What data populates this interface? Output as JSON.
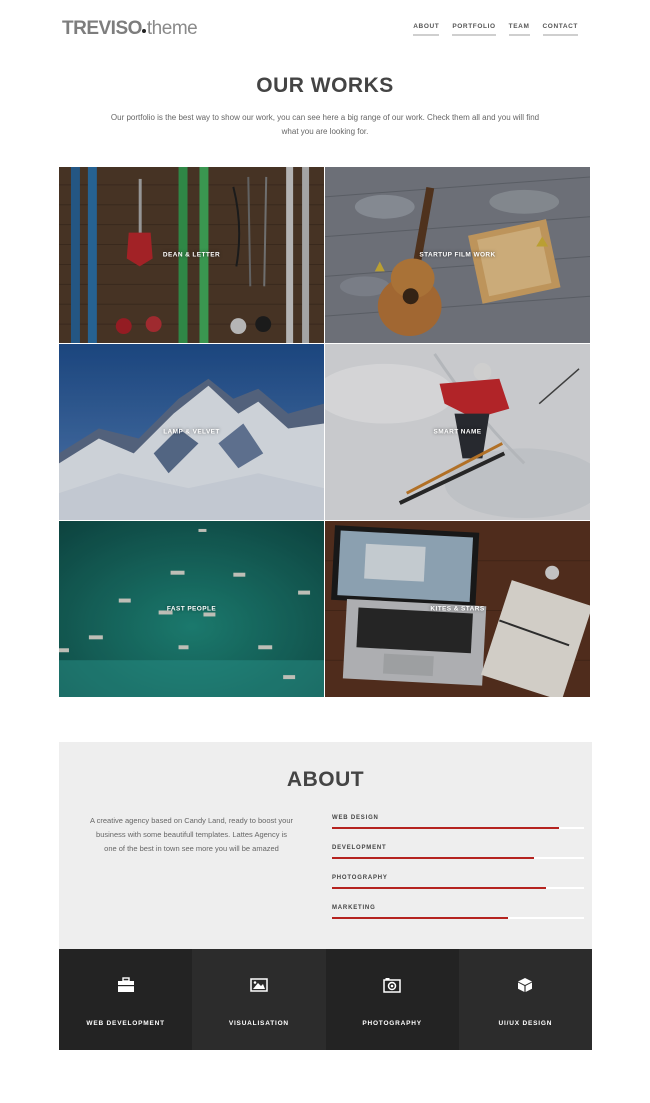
{
  "brand": {
    "logo_bold": "TREVISO",
    "logo_light": "theme"
  },
  "nav": [
    {
      "label": "ABOUT"
    },
    {
      "label": "PORTFOLIO"
    },
    {
      "label": "TEAM"
    },
    {
      "label": "CONTACT"
    }
  ],
  "works": {
    "title": "OUR WORKS",
    "intro": "Our portfolio is the best way to show our work, you can see here a big range of our work. Check them all and you will find what you are looking for.",
    "items": [
      {
        "label": "DEAN & LETTER",
        "image": "skis-on-wooden-deck"
      },
      {
        "label": "STARTUP FILM WORK",
        "image": "ukulele-and-book"
      },
      {
        "label": "LAMP & VELVET",
        "image": "snowy-mountain"
      },
      {
        "label": "SMART NAME",
        "image": "skier-downhill"
      },
      {
        "label": "FAST PEOPLE",
        "image": "boats-aerial"
      },
      {
        "label": "KITES & STARS",
        "image": "laptop-and-notebook"
      }
    ]
  },
  "about": {
    "title": "ABOUT",
    "text": "A creative agency based on Candy Land, ready to boost your business with some beautifull templates. Lattes Agency is one of the best in town see more you will be amazed",
    "accent_color": "#b5231f",
    "skills": [
      {
        "name": "WEB DESIGN",
        "level": 0.9
      },
      {
        "name": "DEVELOPMENT",
        "level": 0.8
      },
      {
        "name": "PHOTOGRAPHY",
        "level": 0.85
      },
      {
        "name": "MARKETING",
        "level": 0.7
      }
    ]
  },
  "services": [
    {
      "label": "WEB DEVELOPMENT",
      "icon": "briefcase-icon"
    },
    {
      "label": "VISUALISATION",
      "icon": "image-icon"
    },
    {
      "label": "PHOTOGRAPHY",
      "icon": "camera-icon"
    },
    {
      "label": "UI/UX DESIGN",
      "icon": "cube-icon"
    }
  ]
}
